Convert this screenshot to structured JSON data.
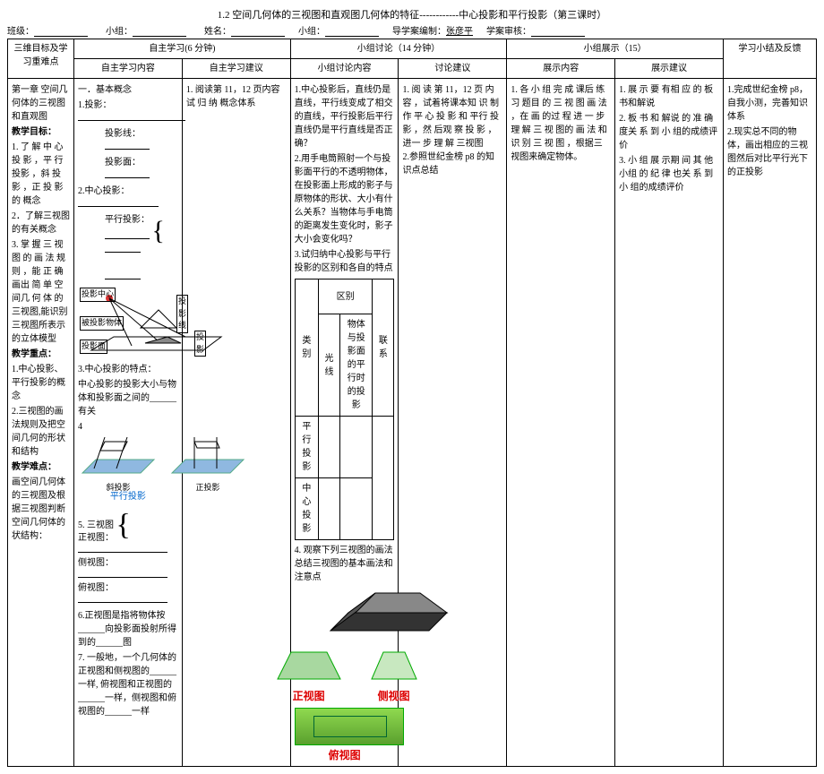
{
  "header": {
    "title": "1.2 空间几何体的三视图和直观图几何体的特征------------中心投影和平行投影（第三课时）",
    "meta_labels": {
      "class": "班级：",
      "group": "小组：",
      "name": "姓名：",
      "sub": "小组：",
      "editor_label": "导学案编制：",
      "editor_name": "张彦平",
      "review_label": "学案审核："
    }
  },
  "columns": {
    "objectives_header": "三维目标及学习重难点",
    "selfstudy_header": "自主学习(6 分钟)",
    "selfstudy_content_header": "自主学习内容",
    "selfstudy_suggest_header": "自主学习建议",
    "discuss_header": "小组讨论（14 分钟）",
    "discuss_content_header": "小组讨论内容",
    "discuss_suggest_header": "讨论建议",
    "show_header": "小组展示（15）",
    "show_content_header": "展示内容",
    "show_suggest_header": "展示建议",
    "summary_header": "学习小结及反馈"
  },
  "objectives": {
    "chapter": "第一章  空间几何体的三视图和直观图",
    "goal_title": "教学目标：",
    "goal1": "1. 了 解 中 心投 影 ，平 行 投影 ，斜 投 影 ，正 投 影 的 概念",
    "goal2": "2．了解三视图的有关概念",
    "goal3": "3. 掌 握 三 视图 的 画 法 规则 ，能 正 确 画出 简 单 空 间几 何 体 的 三视图,能识别三视图所表示的立体模型",
    "focus_title": "教学重点：",
    "focus1": "1.中心投影、平行投影的概念",
    "focus2": "2.三视图的画法规则及把空间几何的形状和结构",
    "hard_title": "教学难点：",
    "hard": "画空间几何体的三视图及根据三视图判断空间几何体的状结构："
  },
  "selfstudy": {
    "section1": "一．基本概念",
    "item1": "1.投影：",
    "item1a": "投影线：",
    "item1b": "投影面：",
    "item2": "2.中心投影：",
    "item2a": "平行投影：",
    "diagram_labels": {
      "center": "投影中心",
      "line": "投影线",
      "object": "被投影物体",
      "plane": "投影面",
      "shadow": "投影",
      "oblique_label": "斜投影",
      "parallel_label": "平行投影",
      "ortho_label": "正投影"
    },
    "item3": "3.中心投影的特点：",
    "item3_text": "中心投影的投影大小与物体和投影面之间的______有关",
    "item4": "4",
    "item5_prefix": "5. 三视图",
    "view_front": "正视图：",
    "view_side": "侧视图：",
    "view_top": "俯视图：",
    "item6": "6.正视图是指将物体按______向投影面投射所得到的______图",
    "item7": "7. 一般地，一个几何体的正视图和侧视图的______一样, 俯视图和正视图的______一样，侧视图和俯视图的______一样"
  },
  "selfstudy_suggest": {
    "s1": "1. 阅读第 11，12 页内容 试 归 纳 概念体系"
  },
  "discuss": {
    "d1": "1.中心投影后，直线仍是直线，平行线变成了相交的直线，平行投影后平行直线仍是平行直线是否正确？",
    "d2": "2.用手电筒照射一个与投影面平行的不透明物体，在投影面上形成的影子与原物体的形状、大小有什么关系？当物体与手电筒的距离发生变化时，影子大小会变化吗？",
    "d3": "3.试归纳中心投影与平行投影的区别和各自的特点",
    "table": {
      "h_diff": "区别",
      "h_type": "类别",
      "h_light": "光线",
      "h_relation": "物体与投影面的平行时的投影",
      "h_link": "联系",
      "row1": "平行投影",
      "row2": "中心投影"
    },
    "d4": "4. 观察下列三视图的画法总结三视图的基本画法和注意点",
    "view_labels": {
      "front": "正视图",
      "side": "侧视图",
      "top": "俯视图"
    }
  },
  "discuss_suggest": {
    "text": "1. 阅 读 第 11，12 页 内 容 ，试着将课本知 识 制 作 平 心 投 影 和 平行 投 影 ，然 后观 察 投 影 ，进一 步 理 解 三视图\n2.参照世纪金榜 p8 的知识点总结"
  },
  "show_content": {
    "text": "1. 各 小 组 完 成 课后 练 习 题目 的 三 视 图 画 法 ，在 画 的过 程 进 一 步 理 解 三 视 图的 画 法 和 识 别 三 视 图 ，根据三视图来确定物体。"
  },
  "show_suggest": {
    "s1": "1. 展 示 要 有相 应 的 板 书和解说",
    "s2": "2. 板 书 和 解说 的 准 确 度关 系 到 小 组的成绩评价",
    "s3": "3. 小 组 展 示期 间 其 他 小组 的 纪 律 也关 系 到 小 组的成绩评价"
  },
  "summary": {
    "s1": "1.完成世纪金榜 p8，自我小测，完善知识体系",
    "s2": "2.现实总不同的物体，画出相应的三视图然后对比平行光下的正投影"
  }
}
